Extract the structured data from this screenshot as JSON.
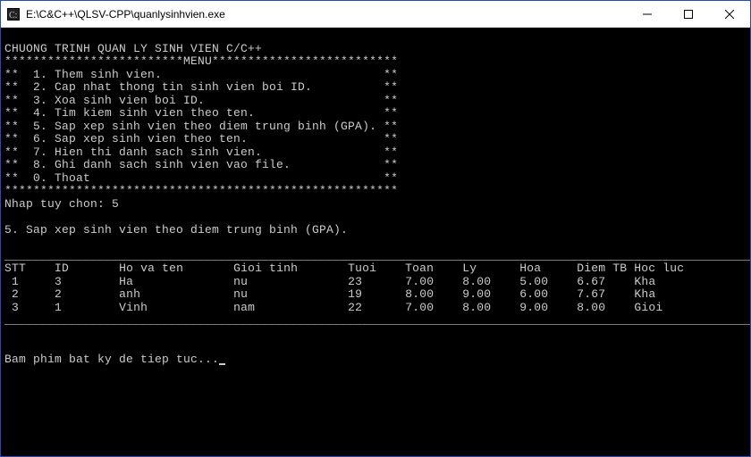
{
  "window": {
    "title": "E:\\C&C++\\QLSV-CPP\\quanlysinhvien.exe"
  },
  "console": {
    "header": "CHUONG TRINH QUAN LY SINH VIEN C/C++",
    "menu_separator_top": "*************************MENU**************************",
    "menu_items": [
      "**  1. Them sinh vien.                               **",
      "**  2. Cap nhat thong tin sinh vien boi ID.          **",
      "**  3. Xoa sinh vien boi ID.                         **",
      "**  4. Tim kiem sinh vien theo ten.                  **",
      "**  5. Sap xep sinh vien theo diem trung binh (GPA). **",
      "**  6. Sap xep sinh vien theo ten.                   **",
      "**  7. Hien thi danh sach sinh vien.                 **",
      "**  8. Ghi danh sach sinh vien vao file.             **",
      "**  0. Thoat                                         **",
      "*******************************************************"
    ],
    "prompt": "Nhap tuy chon: 5",
    "echo": "5. Sap xep sinh vien theo diem trung binh (GPA).",
    "table": {
      "rule": "_______________________________________________________________________________________________________________",
      "headers": [
        "STT",
        "ID",
        "Ho va ten",
        "Gioi tinh",
        "Tuoi",
        "Toan",
        "Ly",
        "Hoa",
        "Diem TB",
        "Hoc luc"
      ],
      "rows": [
        {
          "stt": "1",
          "id": "3",
          "name": "Ha",
          "gender": "nu",
          "age": "23",
          "toan": "7.00",
          "ly": "8.00",
          "hoa": "5.00",
          "tb": "6.67",
          "hocluc": "Kha"
        },
        {
          "stt": "2",
          "id": "2",
          "name": "anh",
          "gender": "nu",
          "age": "19",
          "toan": "8.00",
          "ly": "9.00",
          "hoa": "6.00",
          "tb": "7.67",
          "hocluc": "Kha"
        },
        {
          "stt": "3",
          "id": "1",
          "name": "Vinh",
          "gender": "nam",
          "age": "22",
          "toan": "7.00",
          "ly": "8.00",
          "hoa": "9.00",
          "tb": "8.00",
          "hocluc": "Gioi"
        }
      ]
    },
    "continue_prompt": "Bam phim bat ky de tiep tuc..."
  }
}
